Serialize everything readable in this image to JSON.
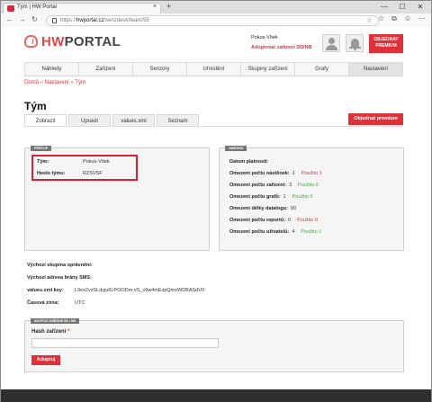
{
  "browser": {
    "tab_title": "Tým | HW Portal",
    "tab_close": "×",
    "new_tab": "+",
    "win_min": "—",
    "win_max": "☐",
    "win_close": "✕",
    "back": "←",
    "forward": "→",
    "reload": "↻",
    "url_prefix": "https://",
    "url_host": "hwportal.cz",
    "url_path": "/senzdevk/team/55",
    "star": "☆",
    "extras": [
      "☆",
      "⧉",
      "☺",
      "⋯"
    ]
  },
  "header": {
    "logo_hw": "HW",
    "logo_portal": "PORTAL",
    "account_name": "Pokus-Vítek",
    "account_link": "Adoptovat zařízení SD/NB",
    "order_line1": "OBJEDNAT",
    "order_line2": "PREMIUM"
  },
  "menu": [
    "Náhledy",
    "Zařízení",
    "Senzory",
    "Umístění",
    "Skupiny zařízení",
    "Grafy",
    "Nastavení"
  ],
  "menu_active_index": 6,
  "breadcrumb": {
    "home": "Domů",
    "sep": "»",
    "settings": "Nastavení",
    "current": "Tým"
  },
  "page_title": "Tým",
  "subtabs": [
    "Zobrazit",
    "Upravit",
    "values.xml",
    "Seznam"
  ],
  "premium_button": "Objednat premium",
  "team_panel": {
    "legend": "PŘÍSTUP",
    "team_label": "Tým:",
    "team_value": "Pokus-Vítek",
    "password_label": "Heslo týmu:",
    "password_value": "RZSVSF"
  },
  "limits_panel": {
    "legend": "OMEZENÍ",
    "valid_label": "Datum platnosti:",
    "rows": [
      {
        "label": "Omezení počtu nástěnek:",
        "limit": "1",
        "used": "Použito 1",
        "status": "red"
      },
      {
        "label": "Omezení počtu zařízení:",
        "limit": "3",
        "used": "Použito 0",
        "status": "green"
      },
      {
        "label": "Omezení počtu grafů:",
        "limit": "1",
        "used": "Použito 0",
        "status": "green"
      },
      {
        "label": "Omezení délky datalogu:",
        "limit": "90",
        "used": "",
        "status": ""
      },
      {
        "label": "Omezení počtu reportů:",
        "limit": "0",
        "used": "Použito 0",
        "status": "red"
      },
      {
        "label": "Omezení počtu uživatelů:",
        "limit": "4",
        "used": "Použito 1",
        "status": "green"
      }
    ]
  },
  "info": {
    "default_group_label": "Výchozí skupina oprávnění:",
    "default_group_value": "",
    "sms_gateway_label": "Výchozí adresa brány SMS:",
    "sms_gateway_value": "",
    "values_key_label": "values.xml key:",
    "values_key_value": "L9ex2vzSLdyju6LPOODm-vS_v9w4mEzpQmzWDBASdV0",
    "timezone_label": "Časová zóna:",
    "timezone_value": "UTC"
  },
  "adopt_panel": {
    "legend": "ADOPCE ZAŘÍZENÍ SD / NB",
    "hash_label": "Hash zařízení",
    "required_mark": "*",
    "hash_value": "",
    "submit": "Adoptuj"
  },
  "colors": {
    "accent": "#e0313b",
    "ok": "#3aa64a",
    "legend_bg": "#757575",
    "footer": "#2e2e2e"
  }
}
